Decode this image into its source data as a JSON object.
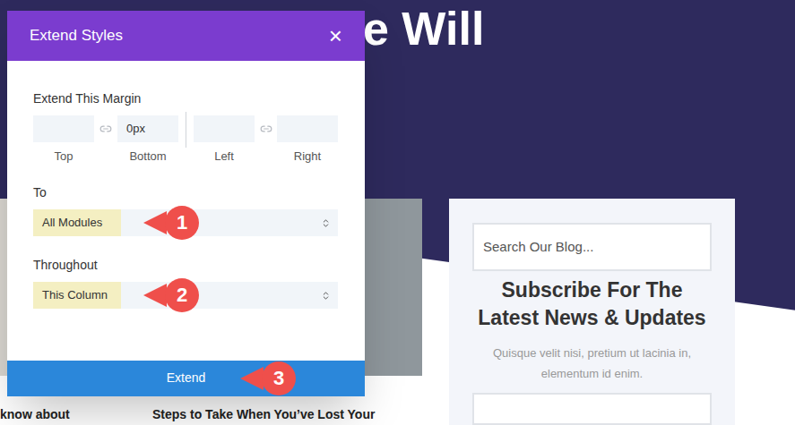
{
  "page": {
    "heading": "e Will",
    "posts": [
      {
        "title": "know about"
      },
      {
        "title": "Steps to Take When You’ve Lost Your"
      }
    ],
    "sidebar": {
      "search_placeholder": "Search Our Blog...",
      "title": "Subscribe For The Latest News & Updates",
      "text": "Quisque velit nisi, pretium ut lacinia in, elementum id enim."
    }
  },
  "dialog": {
    "title": "Extend Styles",
    "close": "×",
    "margin_label": "Extend This Margin",
    "fields": [
      {
        "label": "Top",
        "value": ""
      },
      {
        "label": "Bottom",
        "value": "0px"
      },
      {
        "label": "Left",
        "value": ""
      },
      {
        "label": "Right",
        "value": ""
      }
    ],
    "to": {
      "label": "To",
      "value": "All Modules",
      "callout": "1"
    },
    "throughout": {
      "label": "Throughout",
      "value": "This Column",
      "callout": "2"
    },
    "button": {
      "label": "Extend",
      "callout": "3"
    }
  }
}
